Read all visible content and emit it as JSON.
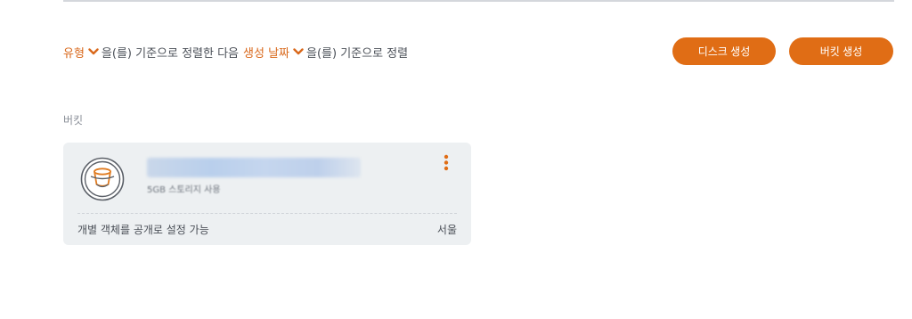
{
  "sort": {
    "field1": "유형",
    "connector1": "을(를) 기준으로 정렬한 다음",
    "field2": "생성 날짜",
    "connector2": "을(를) 기준으로 정렬"
  },
  "actions": {
    "create_disk": "디스크 생성",
    "create_bucket": "버킷 생성"
  },
  "section": {
    "label": "버킷"
  },
  "bucket_card": {
    "name": "",
    "size": "5GB 스토리지 사용",
    "access": "개별 객체를 공개로 설정 가능",
    "region": "서울"
  },
  "colors": {
    "accent": "#e06d15",
    "link": "#d9681b",
    "card_bg": "#edf0f2"
  },
  "icons": [
    "chevron-down-icon",
    "bucket-icon",
    "more-vertical-icon"
  ]
}
